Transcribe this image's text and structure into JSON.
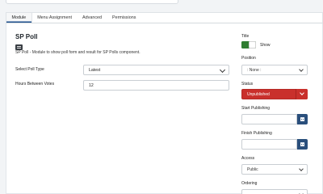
{
  "tabs": [
    "Module",
    "Menu Assignment",
    "Advanced",
    "Permissions"
  ],
  "module": {
    "title": "SP Poll",
    "icon": "module-icon",
    "description": "SP Poll - Module to show poll form and result for SP Polls component."
  },
  "fields": {
    "poll_type_label": "Select Poll Type",
    "poll_type_value": "Latest",
    "hours_label": "Hours Between Votes",
    "hours_value": "12"
  },
  "sidebar": {
    "title_label": "Title",
    "show_label": "Show",
    "position_label": "Position",
    "position_value": ": None :",
    "status_label": "Status",
    "status_value": "Unpublished",
    "start_label": "Start Publishing",
    "finish_label": "Finish Publishing",
    "access_label": "Access",
    "access_value": "Public",
    "ordering_label": "Ordering"
  },
  "colors": {
    "accent": "#1d4f8c",
    "toggle_on": "#2f7d31",
    "status_red": "#c9302c",
    "calendar_button": "#2a4f7c"
  }
}
